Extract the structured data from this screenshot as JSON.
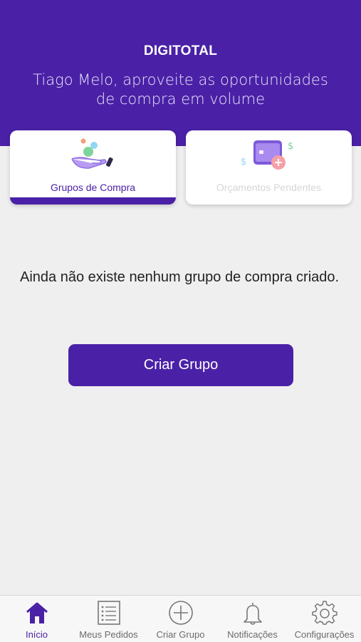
{
  "header": {
    "brand": "DIGITOTAL",
    "subtitle": "Tiago Melo, aproveite as oportunidades de compra em volume"
  },
  "cards": [
    {
      "label": "Grupos de Compra",
      "icon": "hand-coins-icon",
      "active": true
    },
    {
      "label": "Orçamentos Pendentes",
      "icon": "wallet-icon",
      "active": false
    }
  ],
  "main": {
    "empty_message": "Ainda não existe nenhum grupo de compra criado.",
    "create_button": "Criar Grupo"
  },
  "tabbar": {
    "items": [
      {
        "label": "Início",
        "icon": "home-icon",
        "active": true
      },
      {
        "label": "Meus Pedidos",
        "icon": "list-icon",
        "active": false
      },
      {
        "label": "Criar Grupo",
        "icon": "plus-circle-icon",
        "active": false
      },
      {
        "label": "Notificações",
        "icon": "bell-icon",
        "active": false
      },
      {
        "label": "Configurações",
        "icon": "gear-icon",
        "active": false
      }
    ]
  },
  "colors": {
    "primary": "#4a21a6",
    "background": "#efefef",
    "inactive_text": "#6b6b6b"
  }
}
